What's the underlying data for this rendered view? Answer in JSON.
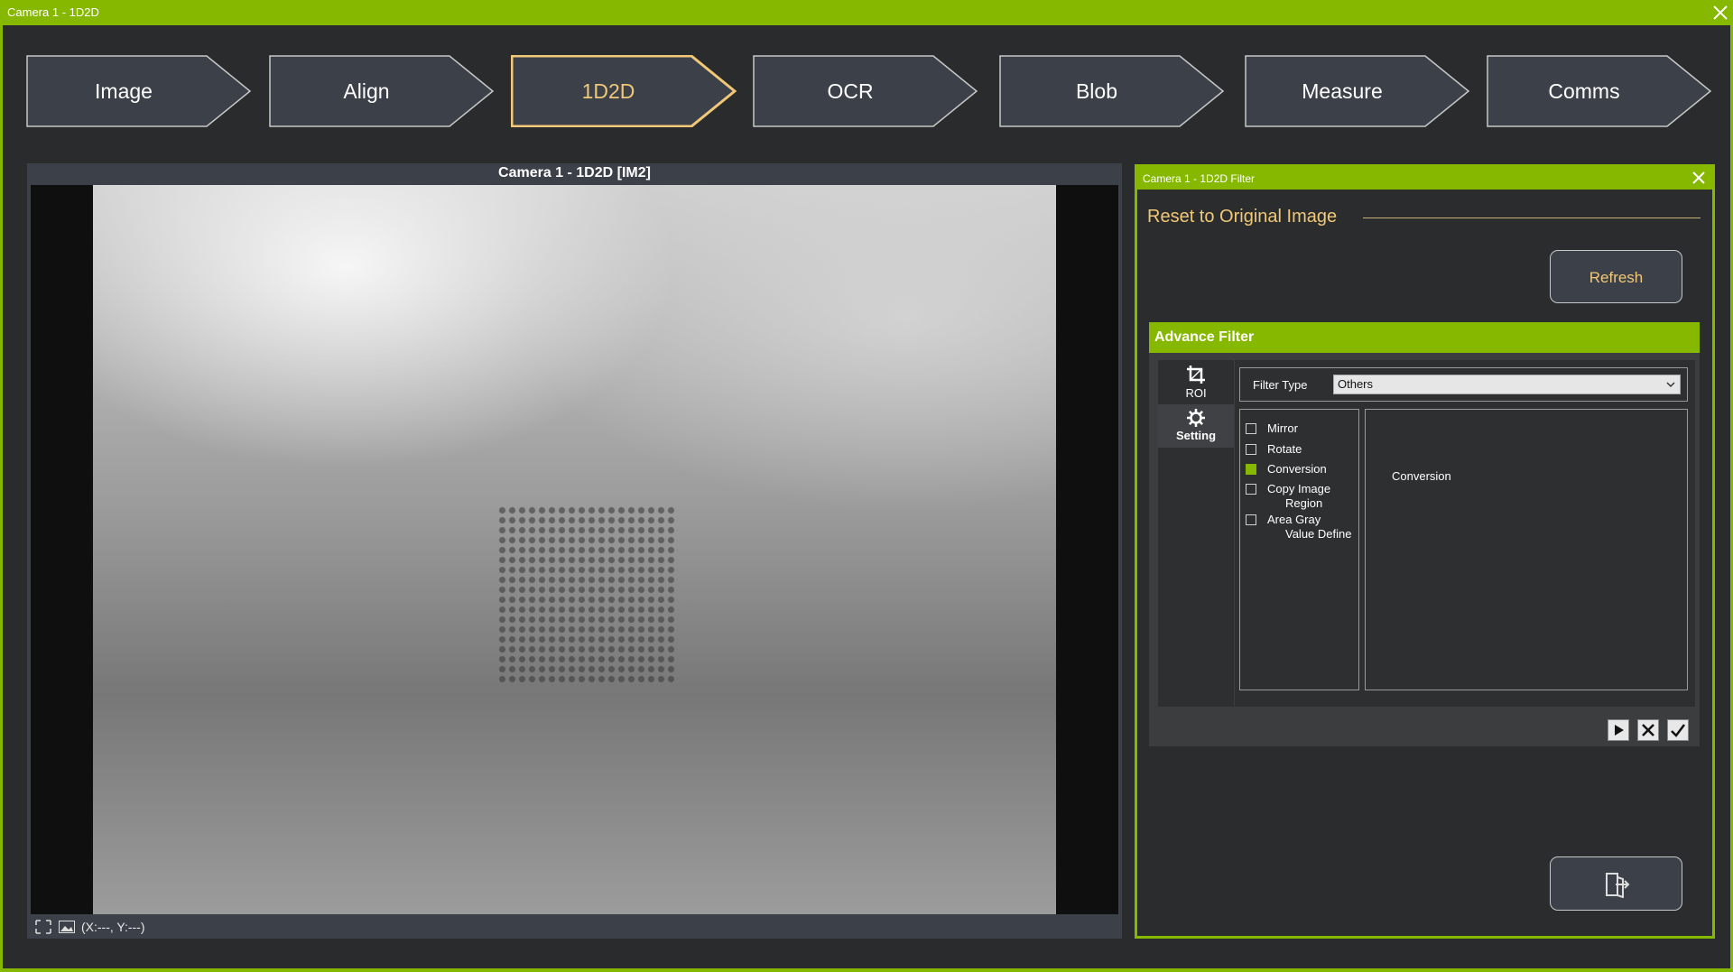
{
  "window": {
    "title": "Camera 1 - 1D2D"
  },
  "steps": [
    {
      "label": "Image",
      "active": false
    },
    {
      "label": "Align",
      "active": false
    },
    {
      "label": "1D2D",
      "active": true
    },
    {
      "label": "OCR",
      "active": false
    },
    {
      "label": "Blob",
      "active": false
    },
    {
      "label": "Measure",
      "active": false
    },
    {
      "label": "Comms",
      "active": false
    }
  ],
  "camera": {
    "title": "Camera 1 - 1D2D  [IM2]",
    "status": "(X:---, Y:---)"
  },
  "filter": {
    "title": "Camera 1 - 1D2D Filter",
    "reset_label": "Reset to Original Image",
    "refresh_label": "Refresh",
    "advance": {
      "title": "Advance Filter",
      "side": {
        "roi": "ROI",
        "setting": "Setting"
      },
      "filter_type_label": "Filter Type",
      "filter_type_value": "Others",
      "options": [
        {
          "line1": "Mirror",
          "line2": "",
          "checked": false
        },
        {
          "line1": "Rotate",
          "line2": "",
          "checked": false
        },
        {
          "line1": "Conversion",
          "line2": "",
          "checked": true
        },
        {
          "line1": "Copy Image",
          "line2": "Region",
          "checked": false
        },
        {
          "line1": "Area Gray",
          "line2": "Value Define",
          "checked": false
        }
      ],
      "detail_text": "Conversion"
    }
  },
  "colors": {
    "accent": "#86b800",
    "active_step": "#f0c878",
    "panel": "#3b4049"
  }
}
